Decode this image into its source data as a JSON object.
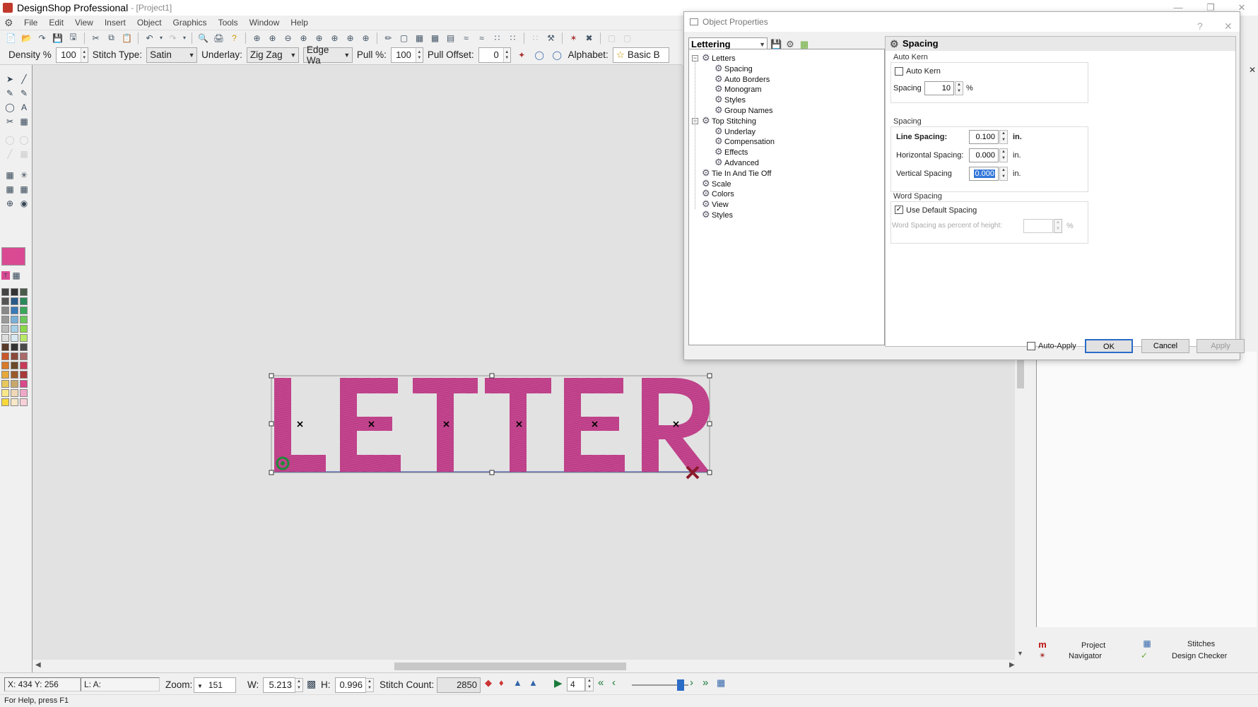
{
  "window": {
    "app_title": "DesignShop Professional",
    "project": "- [Project1]"
  },
  "menu": [
    "File",
    "Edit",
    "View",
    "Insert",
    "Object",
    "Graphics",
    "Tools",
    "Window",
    "Help"
  ],
  "props_toolbar": {
    "density_label": "Density %",
    "density_value": "100",
    "stitch_type_label": "Stitch Type:",
    "stitch_type_value": "Satin",
    "underlay_label": "Underlay:",
    "underlay_value": "Zig Zag",
    "edge_value": "Edge Wa",
    "pull_label": "Pull %:",
    "pull_value": "100",
    "pull_offset_label": "Pull Offset:",
    "pull_offset_value": "0",
    "alphabet_label": "Alphabet:",
    "alphabet_value": "Basic B"
  },
  "design": {
    "text": "LETTER",
    "color": "#c4468f"
  },
  "dialog": {
    "title": "Object Properties",
    "tree_combo": "Lettering",
    "tree": [
      {
        "label": "Letters",
        "level": 0,
        "expander": "−"
      },
      {
        "label": "Spacing",
        "level": 1
      },
      {
        "label": "Auto Borders",
        "level": 1
      },
      {
        "label": "Monogram",
        "level": 1
      },
      {
        "label": "Styles",
        "level": 1
      },
      {
        "label": "Group Names",
        "level": 1
      },
      {
        "label": "Top Stitching",
        "level": 0,
        "expander": "−"
      },
      {
        "label": "Underlay",
        "level": 1
      },
      {
        "label": "Compensation",
        "level": 1
      },
      {
        "label": "Effects",
        "level": 1
      },
      {
        "label": "Advanced",
        "level": 1
      },
      {
        "label": "Tie In And Tie Off",
        "level": 0
      },
      {
        "label": "Scale",
        "level": 0
      },
      {
        "label": "Colors",
        "level": 0
      },
      {
        "label": "View",
        "level": 0
      },
      {
        "label": "Styles",
        "level": 0
      }
    ],
    "pane_title": "Spacing",
    "auto_kern": {
      "group": "Auto Kern",
      "checkbox": "Auto Kern",
      "checked": false,
      "spacing_label": "Spacing",
      "spacing_value": "10",
      "unit": "%"
    },
    "spacing": {
      "group": "Spacing",
      "line_label": "Line Spacing:",
      "line_value": "0.100",
      "horizontal_label": "Horizontal Spacing:",
      "horizontal_value": "0.000",
      "vertical_label": "Vertical Spacing",
      "vertical_value": "0.000",
      "unit": "in."
    },
    "word_spacing": {
      "group": "Word Spacing",
      "checkbox": "Use Default Spacing",
      "checked": true,
      "percent_label": "Word Spacing as percent of height:",
      "unit": "%"
    },
    "auto_apply": "Auto-Apply",
    "ok": "OK",
    "cancel": "Cancel",
    "apply": "Apply"
  },
  "dock": {
    "project": "Project",
    "stitches": "Stitches",
    "navigator": "Navigator",
    "design_checker": "Design Checker"
  },
  "status": {
    "coords": "X: 434  Y: 256",
    "la": "L: A:",
    "zoom_label": "Zoom:",
    "zoom_value": "151",
    "w_label": "W:",
    "w_value": "5.213",
    "h_label": "H:",
    "h_value": "0.996",
    "stitch_count_label": "Stitch Count:",
    "stitch_count_value": "2850",
    "step_value": "4"
  },
  "help_text": "For Help, press F1"
}
